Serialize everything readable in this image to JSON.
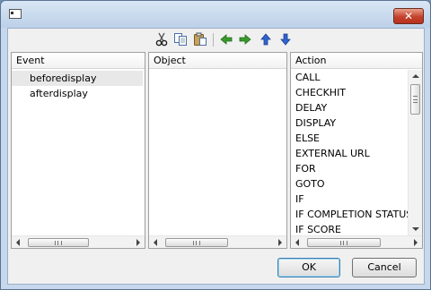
{
  "window": {
    "title": ""
  },
  "toolbar": {
    "icons": [
      "cut-icon",
      "copy-icon",
      "paste-icon",
      "arrow-left-icon",
      "arrow-right-icon",
      "arrow-up-icon",
      "arrow-down-icon"
    ]
  },
  "panels": {
    "event": {
      "header": "Event",
      "items": [
        "beforedisplay",
        "afterdisplay"
      ],
      "selected": "beforedisplay"
    },
    "object": {
      "header": "Object",
      "items": []
    },
    "action": {
      "header": "Action",
      "items": [
        "CALL",
        "CHECKHIT",
        "DELAY",
        "DISPLAY",
        "ELSE",
        "EXTERNAL URL",
        "FOR",
        "GOTO",
        "IF",
        "IF COMPLETION STATUS",
        "IF SCORE"
      ]
    }
  },
  "buttons": {
    "ok": "OK",
    "cancel": "Cancel"
  },
  "scrollbar_grip": "III",
  "colors": {
    "close_button": "#c4412c",
    "default_button_border": "#3c7fb1",
    "icon_green": "#3a9a2c",
    "icon_blue": "#2f63d1"
  }
}
